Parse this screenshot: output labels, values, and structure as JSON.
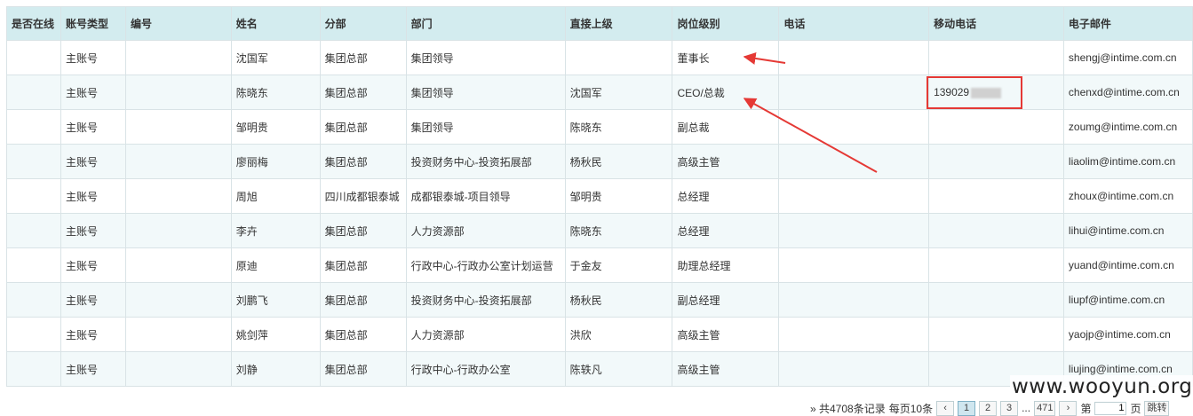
{
  "columns": [
    "是否在线",
    "账号类型",
    "编号",
    "姓名",
    "分部",
    "部门",
    "直接上级",
    "岗位级别",
    "电话",
    "移动电话",
    "电子邮件"
  ],
  "rows": [
    {
      "online": "",
      "type": "主账号",
      "id": "",
      "name": "沈国军",
      "branch": "集团总部",
      "dept": "集团领导",
      "superior": "",
      "level": "董事长",
      "phone": "",
      "mobile": "",
      "email": "shengj@intime.com.cn"
    },
    {
      "online": "",
      "type": "主账号",
      "id": "",
      "name": "陈晓东",
      "branch": "集团总部",
      "dept": "集团领导",
      "superior": "沈国军",
      "level": "CEO/总裁",
      "phone": "",
      "mobile": "139029",
      "email": "chenxd@intime.com.cn"
    },
    {
      "online": "",
      "type": "主账号",
      "id": "",
      "name": "邹明贵",
      "branch": "集团总部",
      "dept": "集团领导",
      "superior": "陈晓东",
      "level": "副总裁",
      "phone": "",
      "mobile": "",
      "email": "zoumg@intime.com.cn"
    },
    {
      "online": "",
      "type": "主账号",
      "id": "",
      "name": "廖丽梅",
      "branch": "集团总部",
      "dept": "投资财务中心-投资拓展部",
      "superior": "杨秋民",
      "level": "高级主管",
      "phone": "",
      "mobile": "",
      "email": "liaolim@intime.com.cn"
    },
    {
      "online": "",
      "type": "主账号",
      "id": "",
      "name": "周旭",
      "branch": "四川成都银泰城",
      "dept": "成都银泰城-项目领导",
      "superior": "邹明贵",
      "level": "总经理",
      "phone": "",
      "mobile": "",
      "email": "zhoux@intime.com.cn"
    },
    {
      "online": "",
      "type": "主账号",
      "id": "",
      "name": "李卉",
      "branch": "集团总部",
      "dept": "人力资源部",
      "superior": "陈晓东",
      "level": "总经理",
      "phone": "",
      "mobile": "",
      "email": "lihui@intime.com.cn"
    },
    {
      "online": "",
      "type": "主账号",
      "id": "",
      "name": "原迪",
      "branch": "集团总部",
      "dept": "行政中心-行政办公室计划运营",
      "superior": "于金友",
      "level": "助理总经理",
      "phone": "",
      "mobile": "",
      "email": "yuand@intime.com.cn"
    },
    {
      "online": "",
      "type": "主账号",
      "id": "",
      "name": "刘鹏飞",
      "branch": "集团总部",
      "dept": "投资财务中心-投资拓展部",
      "superior": "杨秋民",
      "level": "副总经理",
      "phone": "",
      "mobile": "",
      "email": "liupf@intime.com.cn"
    },
    {
      "online": "",
      "type": "主账号",
      "id": "",
      "name": "姚剑萍",
      "branch": "集团总部",
      "dept": "人力资源部",
      "superior": "洪欣",
      "level": "高级主管",
      "phone": "",
      "mobile": "",
      "email": "yaojp@intime.com.cn"
    },
    {
      "online": "",
      "type": "主账号",
      "id": "",
      "name": "刘静",
      "branch": "集团总部",
      "dept": "行政中心-行政办公室",
      "superior": "陈轶凡",
      "level": "高级主管",
      "phone": "",
      "mobile": "",
      "email": "liujing@intime.com.cn"
    }
  ],
  "pager": {
    "total_text": "» 共4708条记录",
    "per_page_text": "每页10条",
    "prev": "‹",
    "pages": [
      "1",
      "2",
      "3"
    ],
    "ellipsis": "...",
    "last": "471",
    "next": "›",
    "goto_prefix": "第",
    "goto_value": "1",
    "goto_suffix": "页",
    "jump_label": "跳转"
  },
  "watermark": "www.wooyun.org",
  "colors": {
    "header_bg": "#d3ecef",
    "alt_row_bg": "#f2f9fa",
    "annotation_red": "#e53935"
  }
}
